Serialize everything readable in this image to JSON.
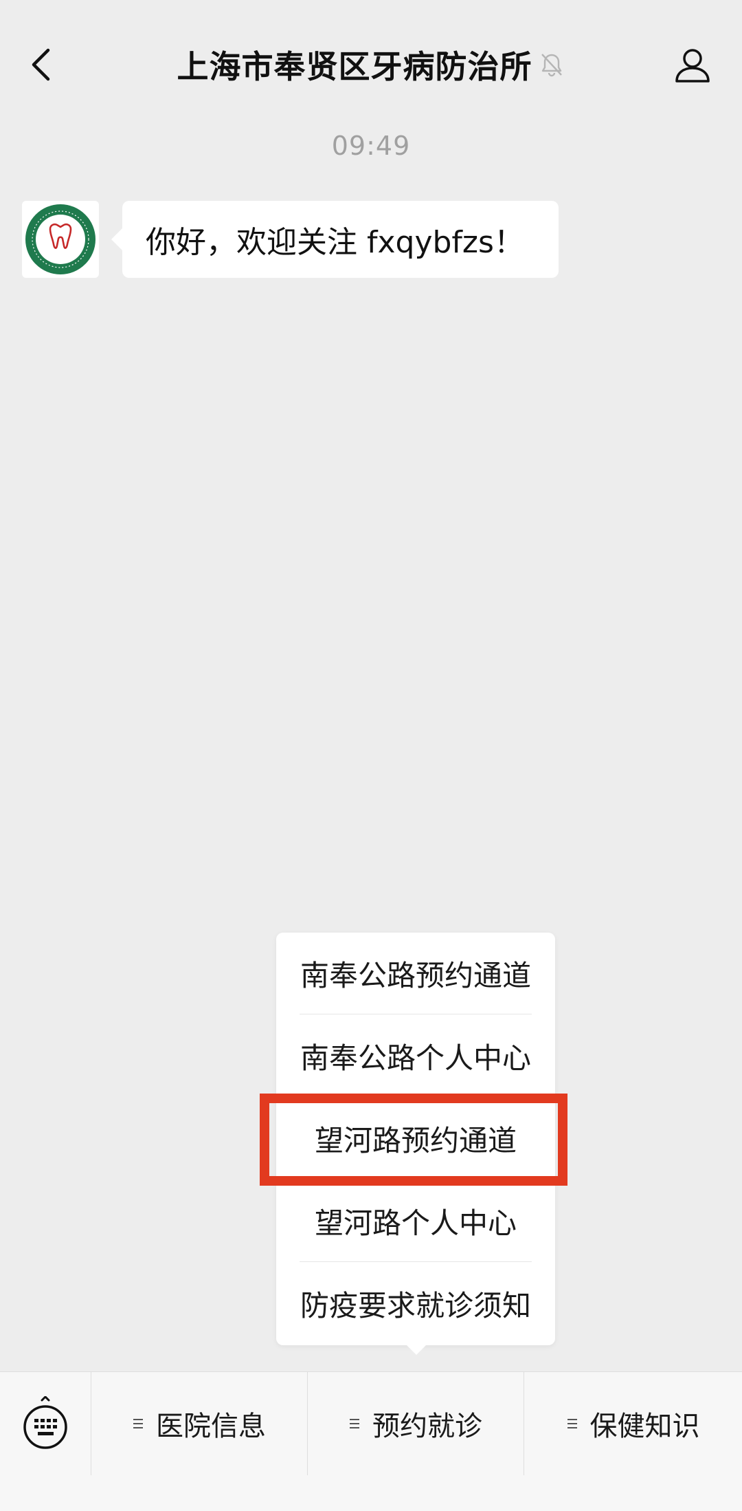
{
  "header": {
    "title": "上海市奉贤区牙病防治所"
  },
  "chat": {
    "time": "09:49",
    "messages": [
      {
        "sender": "official-account",
        "text": "你好，欢迎关注 fxqybfzs！"
      }
    ]
  },
  "popup_menu": {
    "items": [
      {
        "label": "南奉公路预约通道"
      },
      {
        "label": "南奉公路个人中心"
      },
      {
        "label": "望河路预约通道"
      },
      {
        "label": "望河路个人中心"
      },
      {
        "label": "防疫要求就诊须知"
      }
    ],
    "highlight_color": "#e23a1f"
  },
  "bottom_menu": {
    "items": [
      {
        "label": "医院信息"
      },
      {
        "label": "预约就诊"
      },
      {
        "label": "保健知识"
      }
    ]
  },
  "icons": [
    "back-icon",
    "mute-bell-icon",
    "profile-icon",
    "keyboard-icon",
    "menu-lines-icon"
  ]
}
